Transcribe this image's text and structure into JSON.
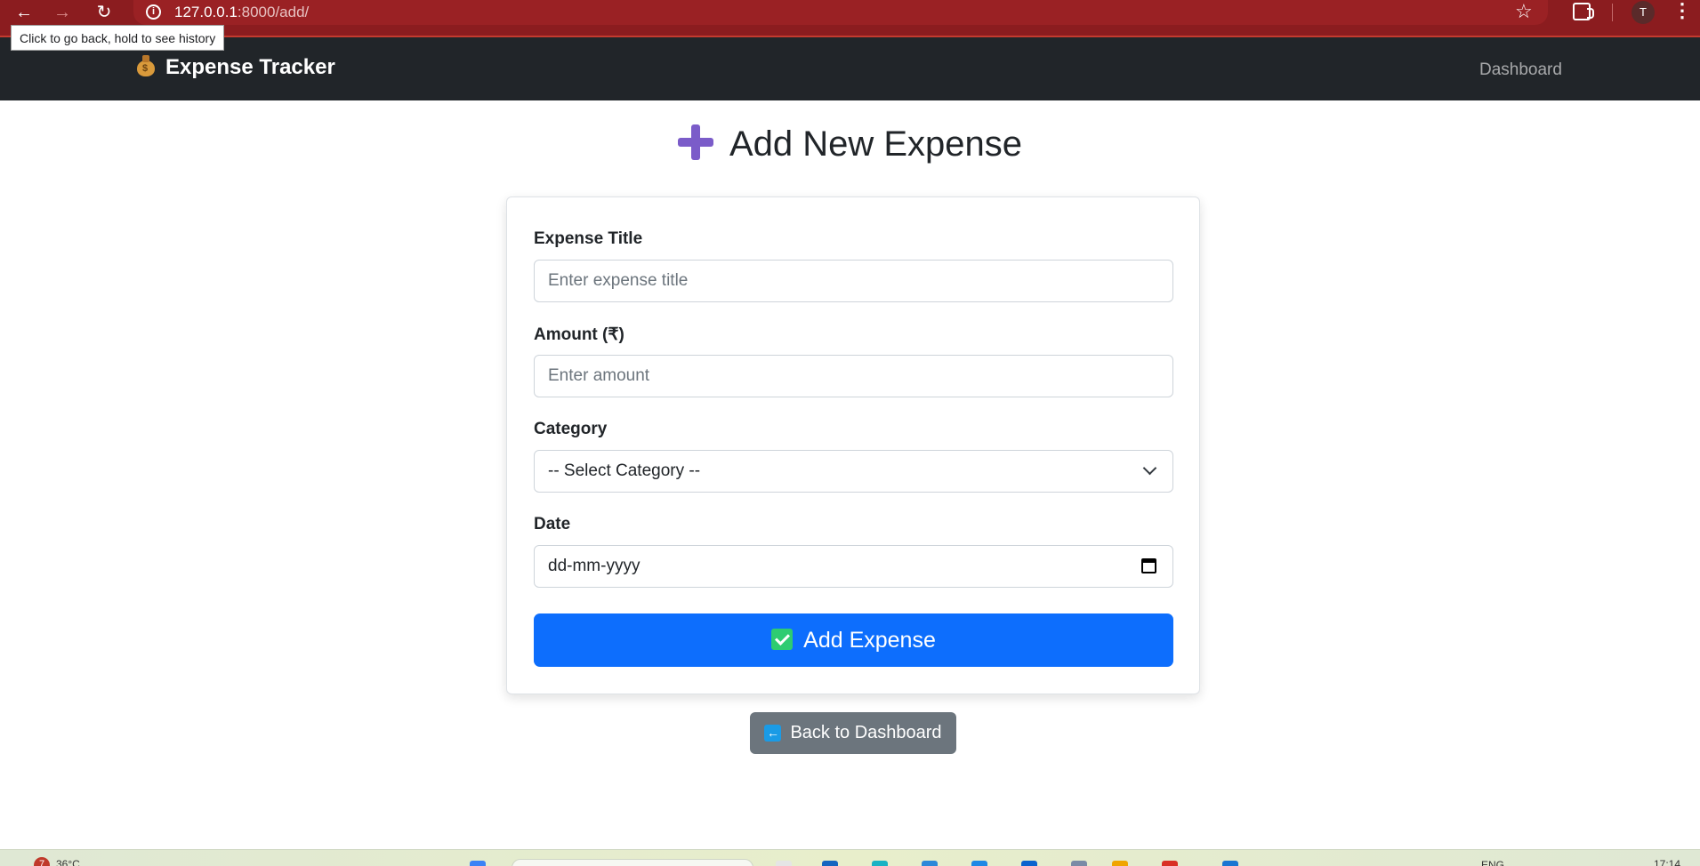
{
  "browser": {
    "url_host": "127.0.0.1",
    "url_rest": ":8000/add/",
    "tooltip": "Click to go back, hold to see history",
    "avatar_letter": "T"
  },
  "navbar": {
    "brand": "Expense Tracker",
    "brand_icon": "money-bag-icon",
    "dashboard_link": "Dashboard"
  },
  "page": {
    "title": "Add New Expense",
    "title_icon": "plus-icon"
  },
  "form": {
    "title_label": "Expense Title",
    "title_placeholder": "Enter expense title",
    "amount_label": "Amount (₹)",
    "amount_placeholder": "Enter amount",
    "category_label": "Category",
    "category_selected": "-- Select Category --",
    "date_label": "Date",
    "date_placeholder": "dd-mm-yyyy",
    "submit_label": "Add Expense"
  },
  "back_button": {
    "label": "Back to Dashboard"
  },
  "taskbar": {
    "notification_count": "7",
    "temperature": "36°C",
    "language": "ENG",
    "time": "17:14"
  },
  "colors": {
    "browser_bar": "#8b1c1f",
    "navbar": "#212529",
    "primary_button": "#0d6efd",
    "secondary_button": "#6c757d",
    "plus_icon": "#7b5cc9"
  }
}
